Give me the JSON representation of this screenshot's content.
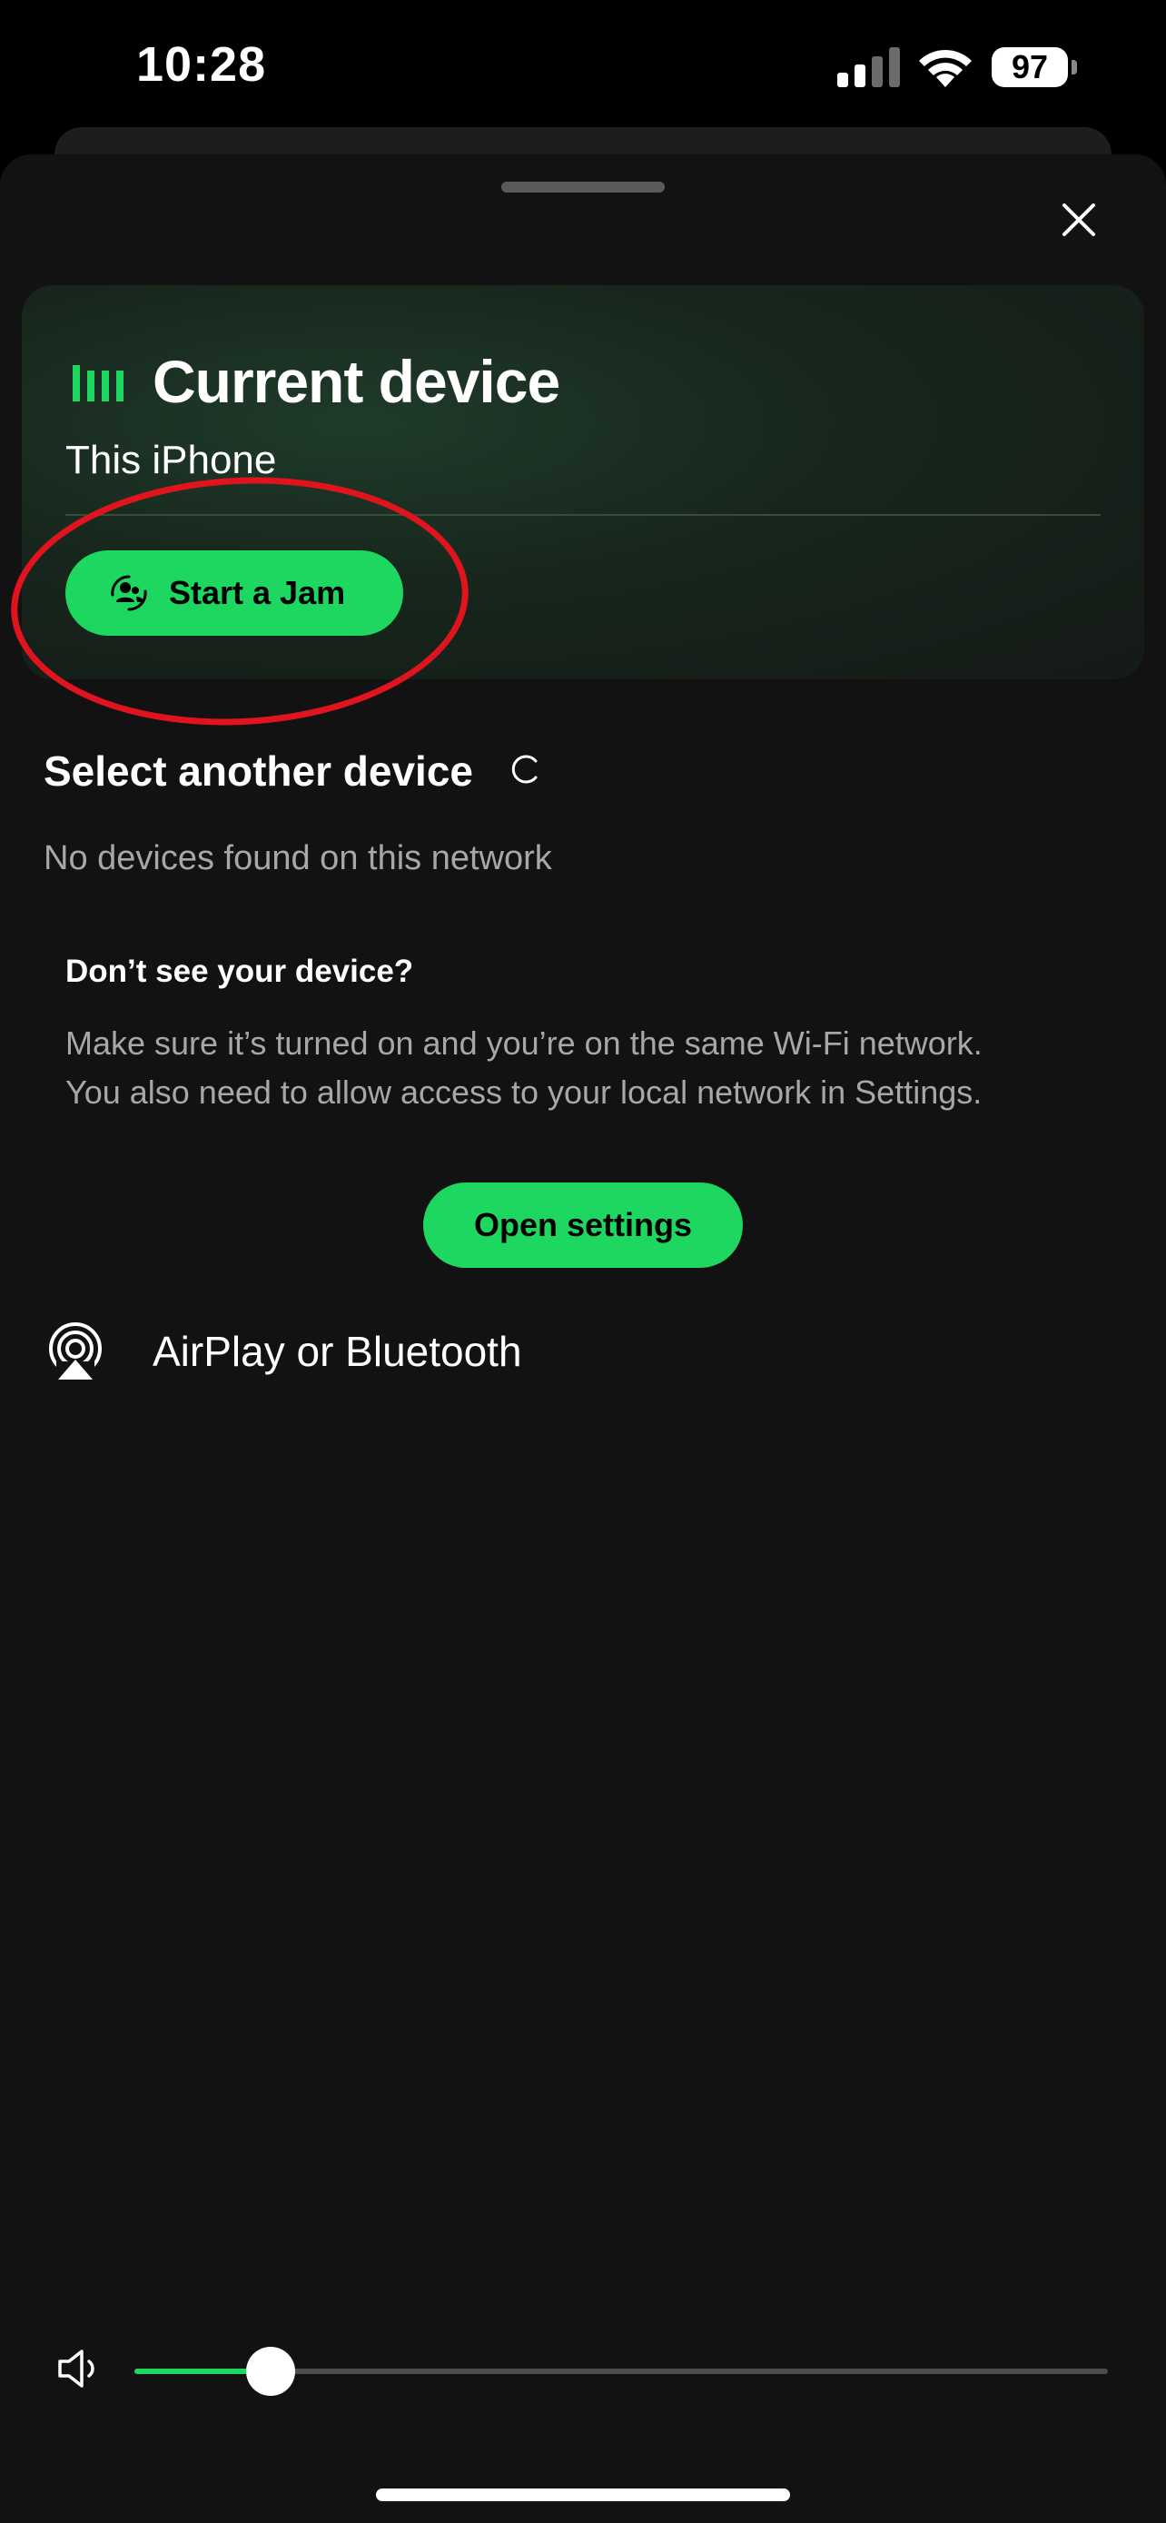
{
  "status_bar": {
    "time": "10:28",
    "battery_level": "97",
    "icons": [
      "cellular-signal-icon",
      "wifi-icon",
      "battery-icon"
    ]
  },
  "sheet": {
    "close_icon": "close-icon"
  },
  "current_device": {
    "heading": "Current device",
    "device_name": "This iPhone",
    "icon": "equalizer-icon",
    "jam_button_label": "Start a Jam",
    "jam_button_icon": "jam-people-icon"
  },
  "other_devices": {
    "heading": "Select another device",
    "loading_icon": "loading-spinner-icon",
    "empty_message": "No devices found on this network",
    "help_heading": "Don’t see your device?",
    "help_body_line1": "Make sure it’s turned on and you’re on the same Wi-Fi network.",
    "help_body_line2": "You also need to allow access to your local network in Settings.",
    "open_settings_label": "Open settings",
    "airplay_label": "AirPlay or Bluetooth",
    "airplay_icon": "airplay-icon"
  },
  "volume": {
    "level": 0.14,
    "icon": "speaker-icon"
  },
  "colors": {
    "accent": "#1ed760",
    "background": "#121212",
    "secondary_text": "#a7a7a7",
    "annotation": "#e0141f"
  }
}
